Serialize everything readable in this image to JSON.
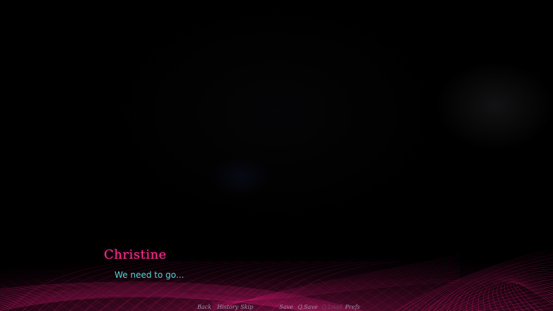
{
  "dialogue": {
    "speaker": "Christine",
    "text": "We need to go..."
  },
  "quick_menu": {
    "back": "Back",
    "history": "History",
    "skip": "Skip",
    "save": "Save",
    "q_save": "Q.Save",
    "q_load": "Q.Load",
    "prefs": "Prefs"
  },
  "colors": {
    "speaker": "#ff2f8f",
    "dialogue_text": "#52d8d8",
    "grid": "#ff1f8a",
    "background": "#000000"
  }
}
